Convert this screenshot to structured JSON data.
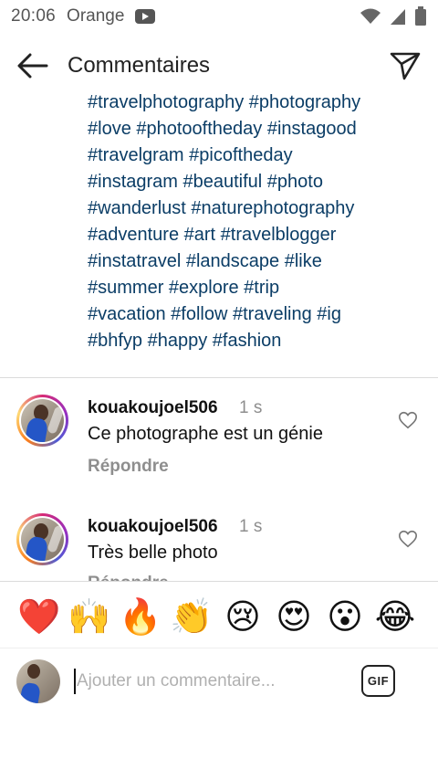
{
  "status_bar": {
    "time": "20:06",
    "carrier": "Orange",
    "icons": [
      "youtube-icon",
      "wifi-icon",
      "signal-icon",
      "battery-icon"
    ]
  },
  "header": {
    "title": "Commentaires",
    "back_icon": "arrow-left-icon",
    "send_icon": "paper-plane-icon"
  },
  "caption": {
    "lines": [
      "#travelphotography #photography",
      "#love #photooftheday #instagood",
      "#travelgram #picoftheday",
      "#instagram #beautiful #photo",
      "#wanderlust #naturephotography",
      "#adventure #art #travelblogger",
      "#instatravel #landscape #like",
      "#summer #explore #trip",
      "#vacation #follow #traveling #ig",
      "#bhfyp #happy #fashion"
    ]
  },
  "comments": [
    {
      "username": "kouakoujoel506",
      "time": "1 s",
      "text": "Ce photographe est un génie",
      "reply_label": "Répondre"
    },
    {
      "username": "kouakoujoel506",
      "time": "1 s",
      "text": "Très belle photo",
      "reply_label": "Répondre"
    }
  ],
  "emoji_bar": {
    "emojis": [
      "❤️",
      "🙌",
      "🔥",
      "👏",
      "😢",
      "😍",
      "😮",
      "😂"
    ]
  },
  "input_bar": {
    "placeholder": "Ajouter un commentaire...",
    "gif_label": "GIF"
  },
  "colors": {
    "hashtag": "#0b3d66",
    "muted": "#8e8e8e",
    "divider": "#dbdbdb"
  }
}
